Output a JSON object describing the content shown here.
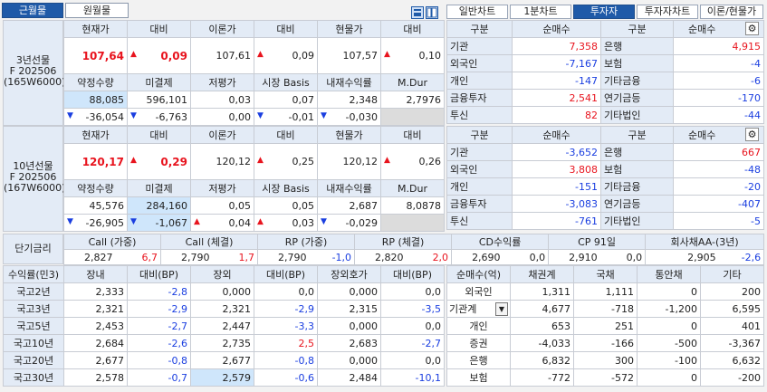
{
  "top_tabs": {
    "near": "근월물",
    "far": "원월물"
  },
  "right_tabs": [
    "일반차트",
    "1분차트",
    "투자자",
    "투자자차트",
    "이론/현물가"
  ],
  "fut3": {
    "label": [
      "3년선물",
      "F 202506",
      "(165W6000)"
    ],
    "h1": [
      "현재가",
      "대비",
      "이론가",
      "대비",
      "현물가",
      "대비"
    ],
    "r1": [
      "107,64",
      "0,09",
      "107,61",
      "0,09",
      "107,57",
      "0,10"
    ],
    "h2": [
      "약정수량",
      "미결제",
      "저평가",
      "시장 Basis",
      "내재수익률",
      "M.Dur"
    ],
    "r2": [
      "88,085",
      "596,101",
      "0,03",
      "0,07",
      "2,348",
      "2,7976"
    ],
    "r3": [
      "-36,054",
      "-6,763",
      "0,00",
      "-0,01",
      "-0,030",
      ""
    ]
  },
  "fut10": {
    "label": [
      "10년선물",
      "F 202506",
      "(167W6000)"
    ],
    "h1": [
      "현재가",
      "대비",
      "이론가",
      "대비",
      "현물가",
      "대비"
    ],
    "r1": [
      "120,17",
      "0,29",
      "120,12",
      "0,25",
      "120,12",
      "0,26"
    ],
    "h2": [
      "약정수량",
      "미결제",
      "저평가",
      "시장 Basis",
      "내재수익률",
      "M.Dur"
    ],
    "r2": [
      "45,576",
      "284,160",
      "0,05",
      "0,05",
      "2,687",
      "8,0878"
    ],
    "r3": [
      "-26,905",
      "-1,067",
      "0,04",
      "0,03",
      "-0,029",
      ""
    ]
  },
  "inv_header": [
    "구분",
    "순매수",
    "구분",
    "순매수"
  ],
  "inv1": [
    [
      "기관",
      "7,358",
      "은행",
      "4,915"
    ],
    [
      "외국인",
      "-7,167",
      "보험",
      "-4"
    ],
    [
      "개인",
      "-147",
      "기타금융",
      "-6"
    ],
    [
      "금융투자",
      "2,541",
      "연기금등",
      "-170"
    ],
    [
      "투신",
      "82",
      "기타법인",
      "-44"
    ]
  ],
  "inv2": [
    [
      "기관",
      "-3,652",
      "은행",
      "667"
    ],
    [
      "외국인",
      "3,808",
      "보험",
      "-48"
    ],
    [
      "개인",
      "-151",
      "기타금융",
      "-20"
    ],
    [
      "금융투자",
      "-3,083",
      "연기금등",
      "-407"
    ],
    [
      "투신",
      "-761",
      "기타법인",
      "-5"
    ]
  ],
  "short_rate": {
    "label": "단기금리",
    "headers": [
      "Call (가중)",
      "Call (체결)",
      "RP (가중)",
      "RP (체결)",
      "CD수익률",
      "CP 91일",
      "회사채AA-(3년)"
    ],
    "values": [
      [
        "2,827",
        "6,7"
      ],
      [
        "2,790",
        "1,7"
      ],
      [
        "2,790",
        "-1,0"
      ],
      [
        "2,820",
        "2,0"
      ],
      [
        "2,690",
        "0,0"
      ],
      [
        "2,910",
        "0,0"
      ],
      [
        "2,905",
        "-2,6"
      ]
    ]
  },
  "yield": {
    "headers": [
      "수익률(민3)",
      "장내",
      "대비(BP)",
      "장외",
      "대비(BP)",
      "장외호가",
      "대비(BP)"
    ],
    "rows": [
      [
        "국고2년",
        "2,333",
        "-2,8",
        "0,000",
        "0,0",
        "0,000",
        "0,0"
      ],
      [
        "국고3년",
        "2,321",
        "-2,9",
        "2,321",
        "-2,9",
        "2,315",
        "-3,5"
      ],
      [
        "국고5년",
        "2,453",
        "-2,7",
        "2,447",
        "-3,3",
        "0,000",
        "0,0"
      ],
      [
        "국고10년",
        "2,684",
        "-2,6",
        "2,735",
        "2,5",
        "2,683",
        "-2,7"
      ],
      [
        "국고20년",
        "2,677",
        "-0,8",
        "2,677",
        "-0,8",
        "0,000",
        "0,0"
      ],
      [
        "국고30년",
        "2,578",
        "-0,7",
        "2,579",
        "-0,6",
        "2,484",
        "-10,1"
      ]
    ]
  },
  "net": {
    "headers": [
      "순매수(억)",
      "채권계",
      "국채",
      "통안채",
      "기타"
    ],
    "rows": [
      [
        "외국인",
        "1,311",
        "1,111",
        "0",
        "200"
      ],
      [
        "기관계",
        "4,677",
        "-718",
        "-1,200",
        "6,595"
      ],
      [
        "개인",
        "653",
        "251",
        "0",
        "401"
      ],
      [
        "증권",
        "-4,033",
        "-166",
        "-500",
        "-3,367"
      ],
      [
        "은행",
        "6,832",
        "300",
        "-100",
        "6,632"
      ],
      [
        "보험",
        "-772",
        "-572",
        "0",
        "-200"
      ]
    ]
  },
  "colors": {
    "up": "#e8141e",
    "down": "#1a3ee0",
    "selected_tab": "#1f5aa8",
    "header_bg": "#e3ebf6"
  }
}
